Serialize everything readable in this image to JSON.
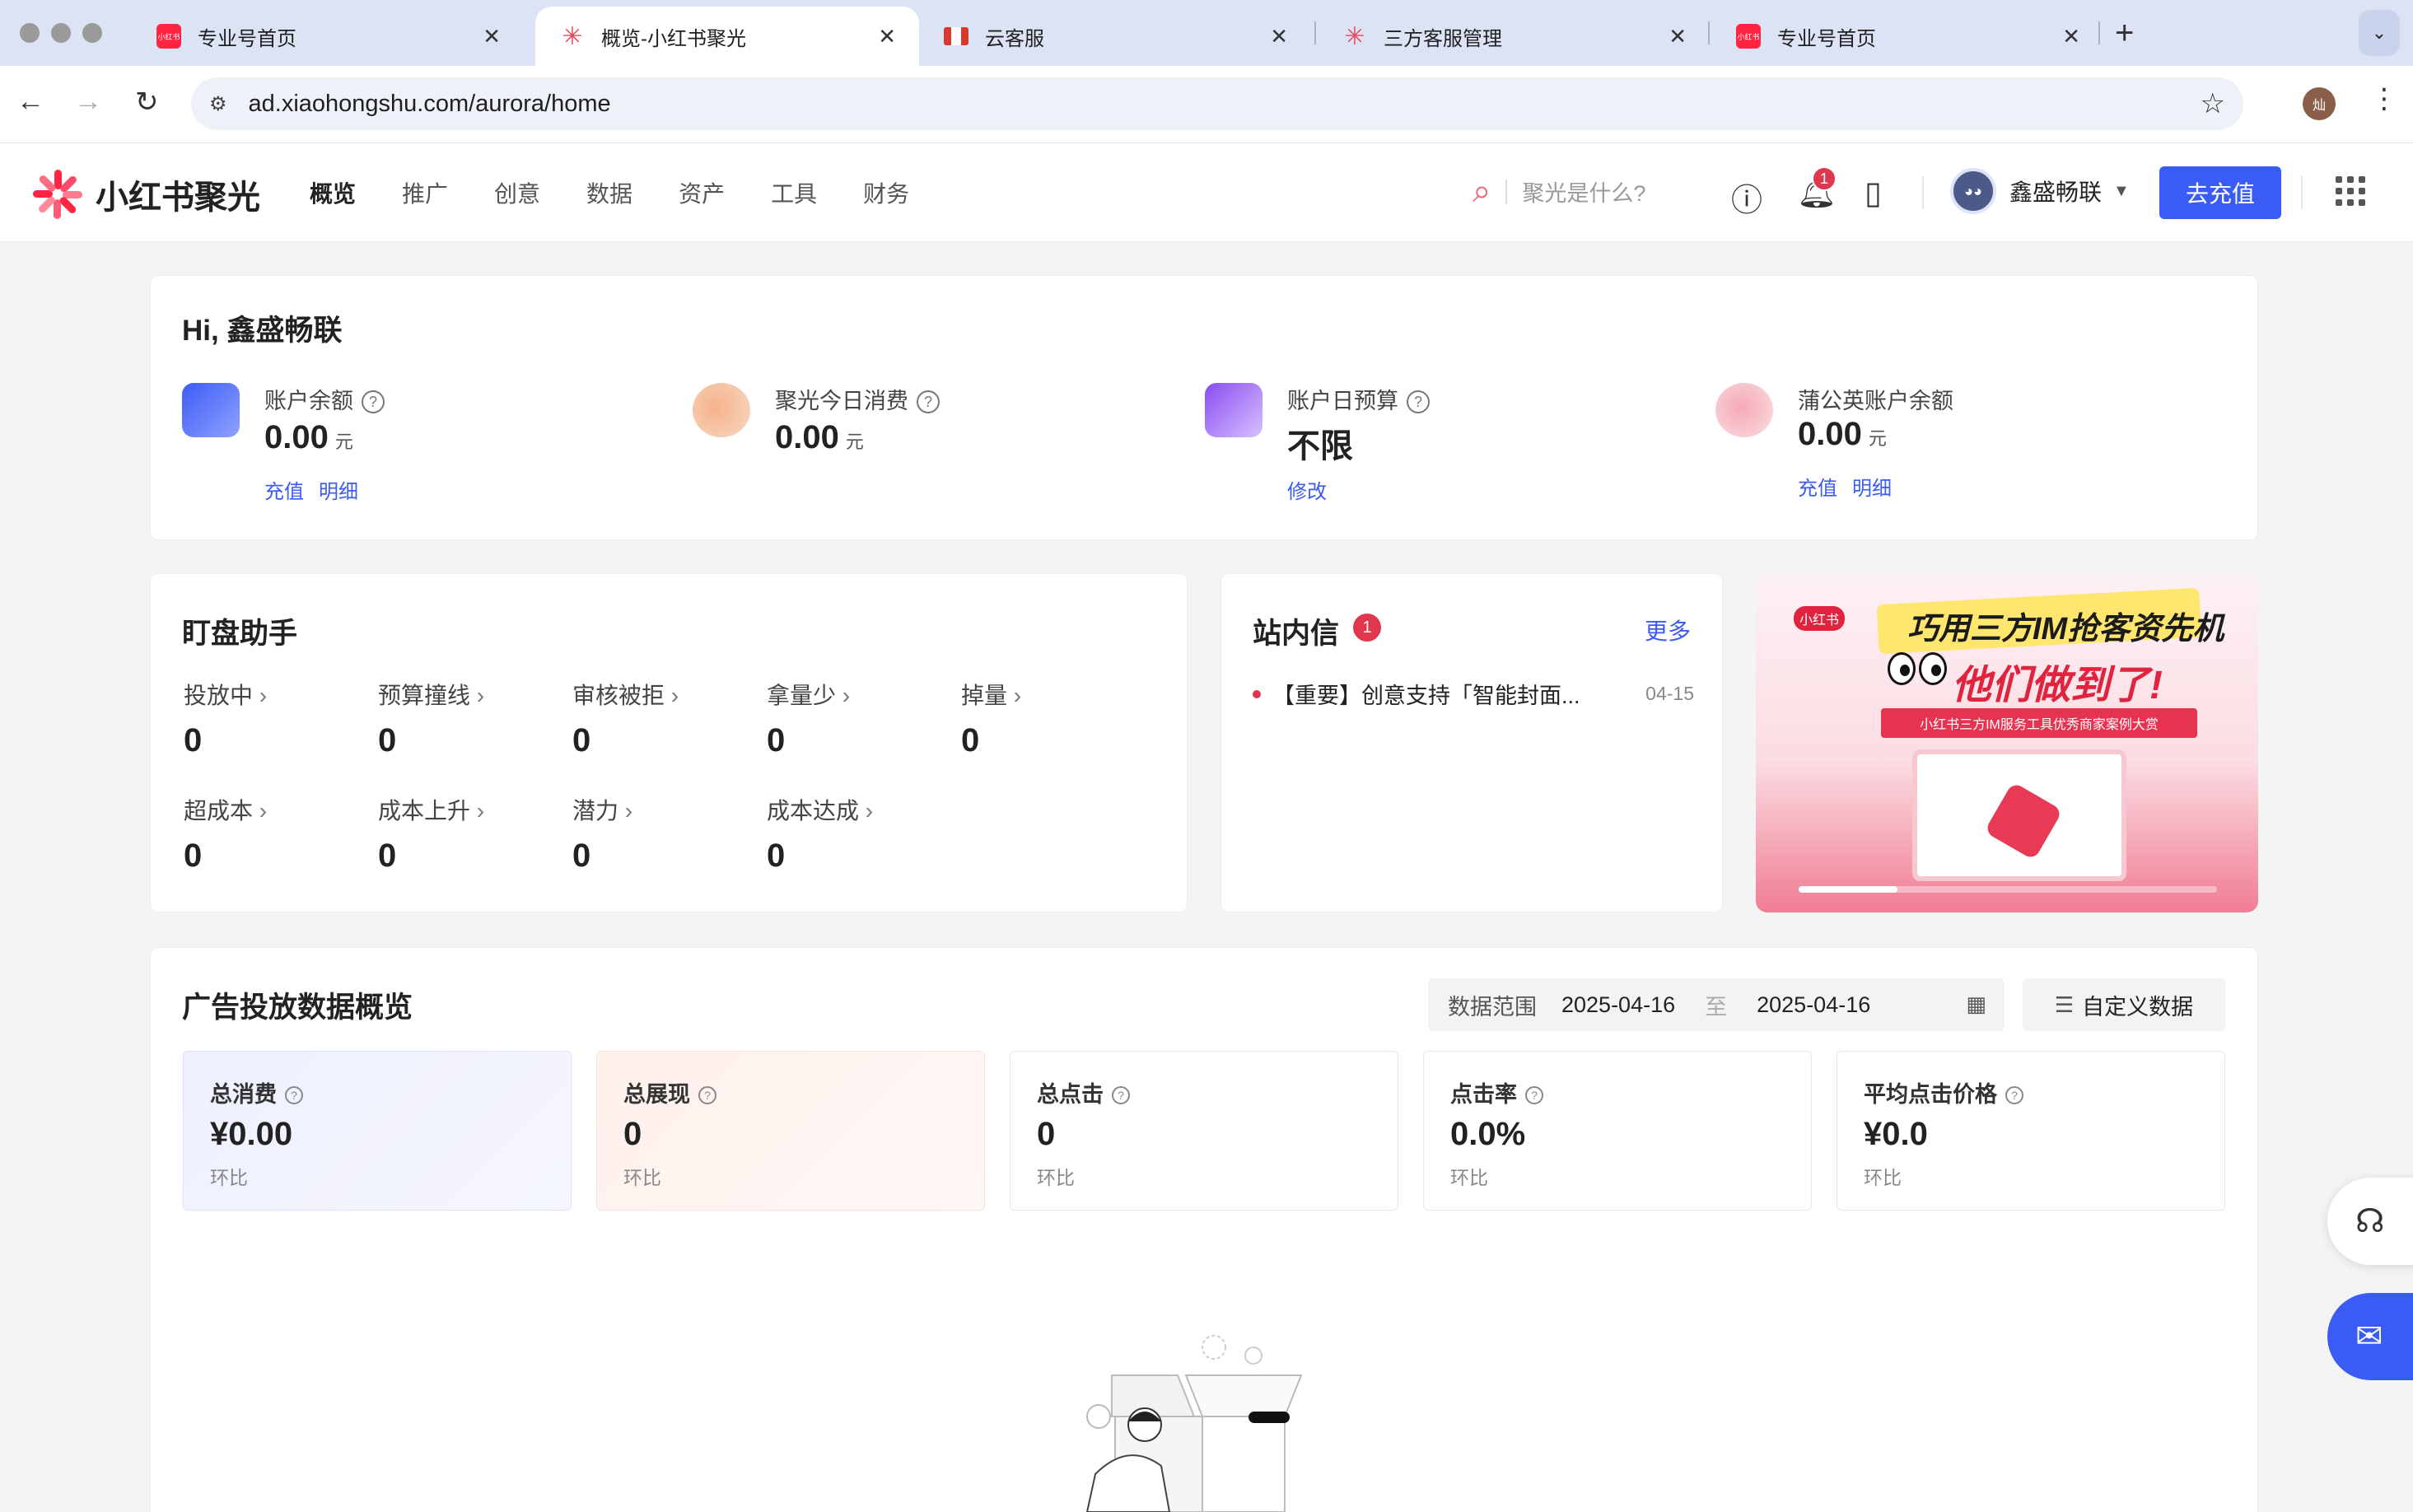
{
  "browser": {
    "tabs": [
      {
        "label": "专业号首页",
        "favicon": "xiaohongshu-icon"
      },
      {
        "label": "概览-小红书聚光",
        "favicon": "xiaohongshu-star-icon",
        "active": true
      },
      {
        "label": "云客服",
        "favicon": "flag-icon"
      },
      {
        "label": "三方客服管理",
        "favicon": "xiaohongshu-star-icon"
      },
      {
        "label": "专业号首页",
        "favicon": "xiaohongshu-icon"
      }
    ],
    "favicon_text": "小红书",
    "url": "ad.xiaohongshu.com/aurora/home",
    "profile_initial": "灿"
  },
  "header": {
    "brand": "小红书聚光",
    "nav": [
      "概览",
      "推广",
      "创意",
      "数据",
      "资产",
      "工具",
      "财务"
    ],
    "active_nav": "概览",
    "search_placeholder": "聚光是什么?",
    "notification_count": "1",
    "user_name": "鑫盛畅联",
    "recharge_button": "去充值"
  },
  "overview": {
    "greeting": "Hi, 鑫盛畅联",
    "metrics": [
      {
        "label": "账户余额",
        "value": "0.00",
        "unit": "元",
        "links": [
          "充值",
          "明细"
        ]
      },
      {
        "label": "聚光今日消费",
        "value": "0.00",
        "unit": "元",
        "links": []
      },
      {
        "label": "账户日预算",
        "value": "不限",
        "unit": "",
        "links": [
          "修改"
        ]
      },
      {
        "label": "蒲公英账户余额",
        "value": "0.00",
        "unit": "元",
        "links": [
          "充值",
          "明细"
        ]
      }
    ],
    "help_mark": "?"
  },
  "monitor": {
    "title": "盯盘助手",
    "stats": [
      {
        "label": "投放中",
        "value": "0"
      },
      {
        "label": "预算撞线",
        "value": "0"
      },
      {
        "label": "审核被拒",
        "value": "0"
      },
      {
        "label": "拿量少",
        "value": "0"
      },
      {
        "label": "掉量",
        "value": "0"
      },
      {
        "label": "超成本",
        "value": "0"
      },
      {
        "label": "成本上升",
        "value": "0"
      },
      {
        "label": "潜力",
        "value": "0"
      },
      {
        "label": "成本达成",
        "value": "0"
      }
    ]
  },
  "inbox": {
    "title": "站内信",
    "badge": "1",
    "more": "更多",
    "messages": [
      {
        "text": "【重要】创意支持「智能封面...",
        "date": "04-15"
      }
    ]
  },
  "banner": {
    "logo": "小红书",
    "headline": "巧用三方IM抢客资先机",
    "subheadline": "他们做到了!",
    "tagline": "小红书三方IM服务工具优秀商家案例大赏"
  },
  "ad_data": {
    "title": "广告投放数据概览",
    "range_label": "数据范围",
    "start_date": "2025-04-16",
    "range_sep": "至",
    "end_date": "2025-04-16",
    "custom_button": "自定义数据",
    "kpis": [
      {
        "label": "总消费",
        "value": "¥0.00",
        "compare": "环比"
      },
      {
        "label": "总展现",
        "value": "0",
        "compare": "环比"
      },
      {
        "label": "总点击",
        "value": "0",
        "compare": "环比"
      },
      {
        "label": "点击率",
        "value": "0.0%",
        "compare": "环比"
      },
      {
        "label": "平均点击价格",
        "value": "¥0.0",
        "compare": "环比"
      }
    ]
  },
  "colors": {
    "accent": "#3b5bf5",
    "brand_red": "#ff2442",
    "badge_red": "#e0364e"
  }
}
